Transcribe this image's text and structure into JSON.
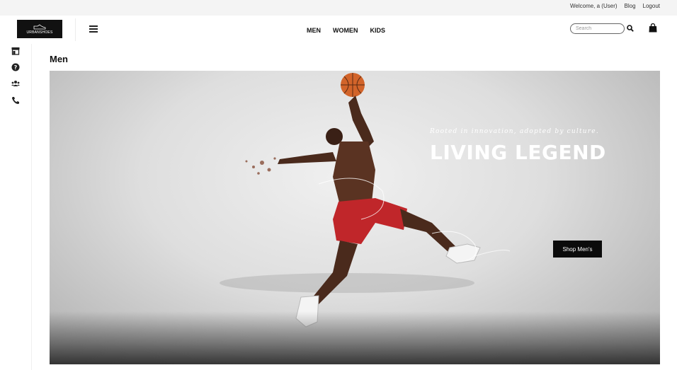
{
  "topbar": {
    "welcome": "Welcome, a (User)",
    "blog": "Blog",
    "logout": "Logout"
  },
  "header": {
    "logo_text": "URBANSHOES",
    "nav": [
      "MEN",
      "WOMEN",
      "KIDS"
    ],
    "search_placeholder": "Search",
    "icons": {
      "menu": "hamburger-menu-icon",
      "search": "search-icon",
      "cart": "shopping-bag-icon"
    }
  },
  "sidebar": {
    "icons": [
      "store-icon",
      "help-icon",
      "users-icon",
      "phone-icon"
    ]
  },
  "page": {
    "title": "Men"
  },
  "hero": {
    "tagline": "Rooted in innovation, adopted by culture.",
    "headline": "LIVING LEGEND",
    "cta_label": "Shop Men's"
  },
  "colors": {
    "topbar_bg": "#f4f4f4",
    "logo_bg": "#111111",
    "cta_bg": "#0b0b0b",
    "shorts": "#c0262a",
    "ball": "#d2642a"
  }
}
